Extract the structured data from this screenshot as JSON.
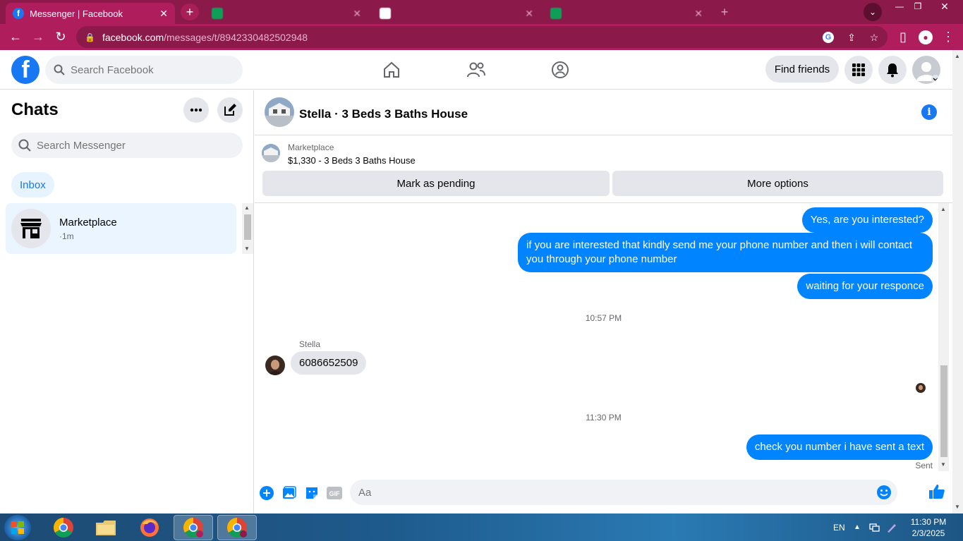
{
  "browser": {
    "active_tab_title": "Messenger | Facebook",
    "url_host": "facebook.com",
    "url_path": "/messages/t/8942330482502948"
  },
  "fb_nav": {
    "search_placeholder": "Search Facebook",
    "find_friends_label": "Find friends"
  },
  "sidebar": {
    "title": "Chats",
    "search_placeholder": "Search Messenger",
    "inbox_label": "Inbox",
    "chats": [
      {
        "name": "Marketplace",
        "meta": "·1m"
      }
    ]
  },
  "conversation": {
    "title": "Stella · 3 Beds 3 Baths House",
    "marketplace_label": "Marketplace",
    "listing": "$1,330 - 3 Beds 3 Baths House",
    "mark_pending_label": "Mark as pending",
    "more_options_label": "More options",
    "messages": [
      {
        "from": "me",
        "text": "Yes, are you interested?"
      },
      {
        "from": "me",
        "text": "if you are interested that kindly send me your phone number and then i will contact you through your phone number"
      },
      {
        "from": "me",
        "text": "waiting for your responce"
      },
      {
        "from": "time",
        "text": "10:57 PM"
      },
      {
        "from": "sender-name",
        "text": "Stella"
      },
      {
        "from": "them",
        "text": "6086652509"
      },
      {
        "from": "time",
        "text": "11:30 PM"
      },
      {
        "from": "me",
        "text": "check you number i have sent a text"
      }
    ],
    "sent_status": "Sent",
    "composer_placeholder": "Aa"
  },
  "taskbar": {
    "language": "EN",
    "time": "11:30 PM",
    "date": "2/3/2025"
  },
  "colors": {
    "brand_blue": "#1877f2",
    "outgoing_bubble": "#0084ff",
    "browser_frame": "#b01d5c"
  }
}
